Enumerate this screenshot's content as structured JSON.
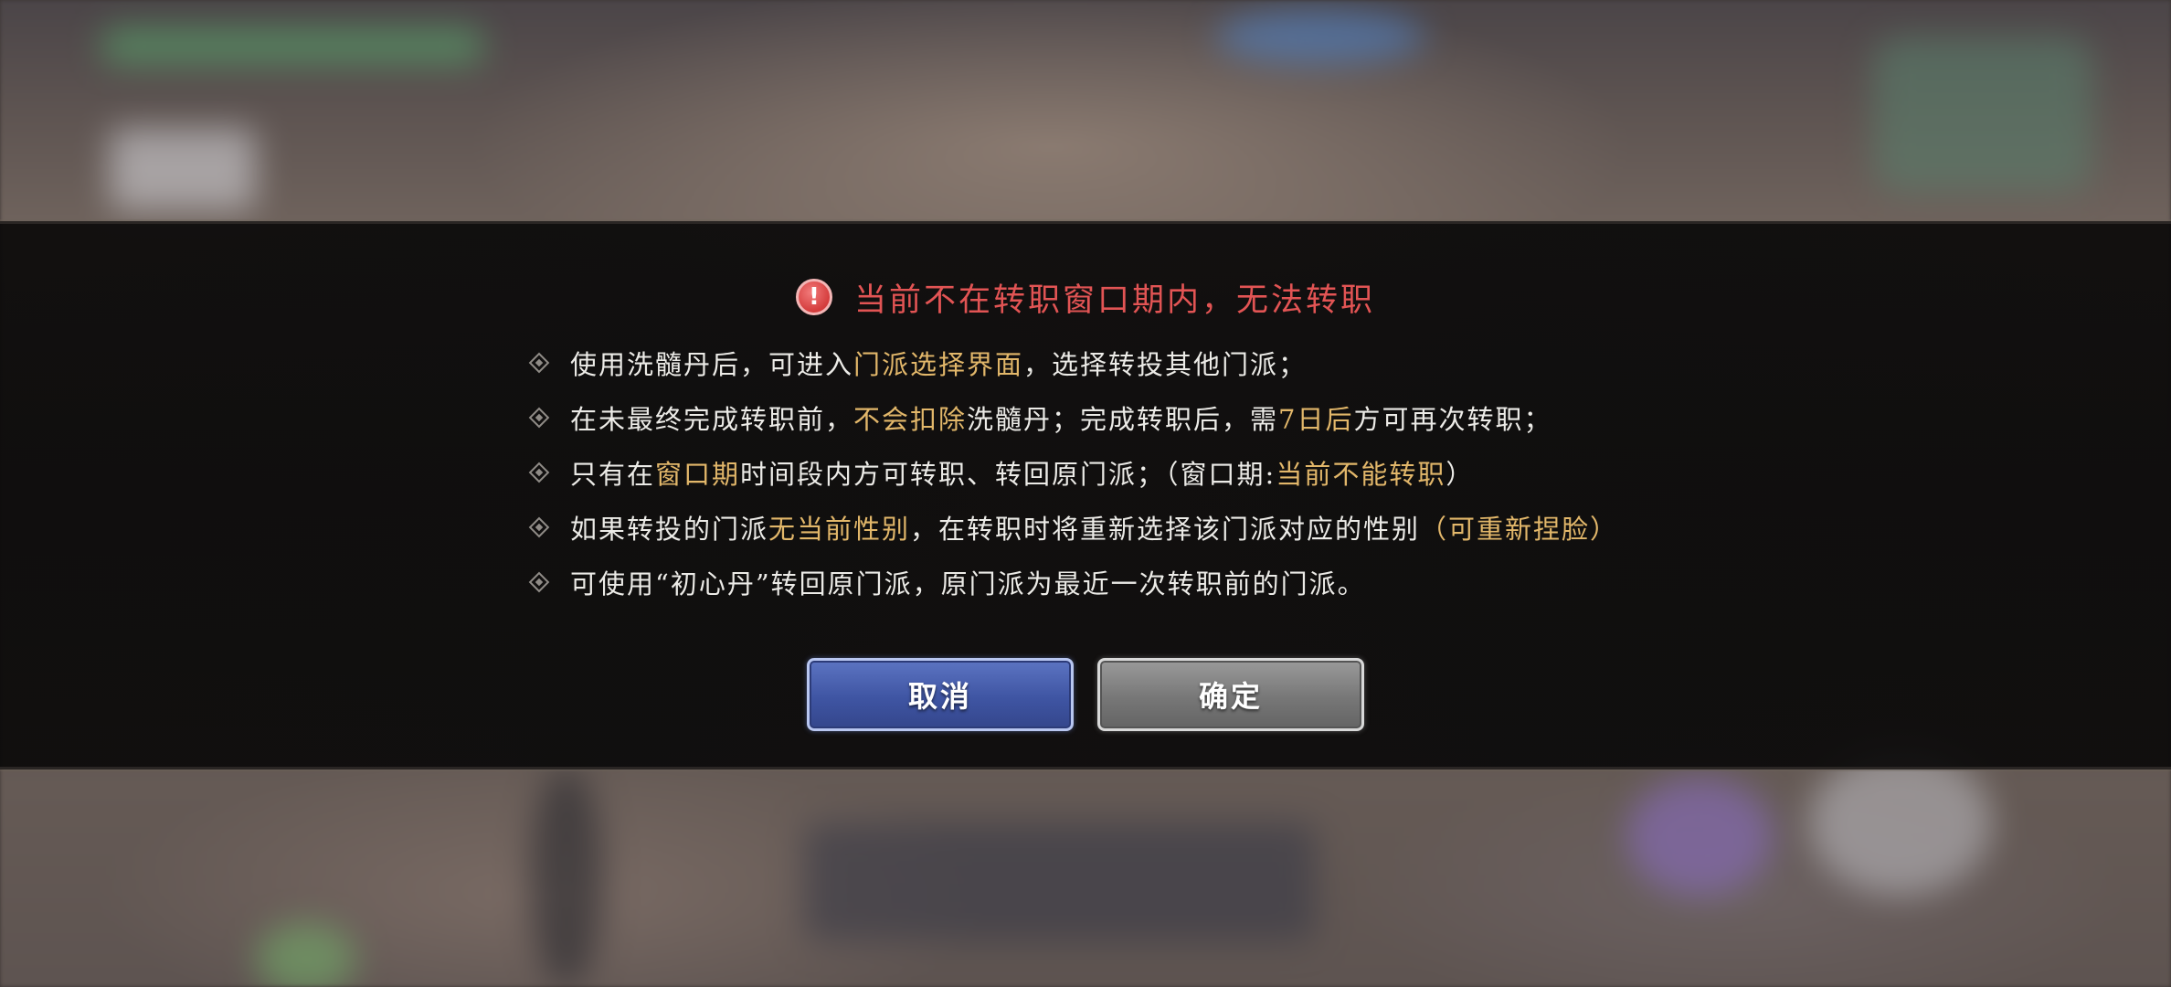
{
  "dialog": {
    "icon": "warning-icon",
    "icon_glyph": "!",
    "title": "当前不在转职窗口期内，无法转职",
    "rules": [
      {
        "parts": [
          {
            "text": "使用洗髓丹后，可进入",
            "highlight": false
          },
          {
            "text": "门派选择界面",
            "highlight": true
          },
          {
            "text": "，选择转投其他门派；",
            "highlight": false
          }
        ]
      },
      {
        "parts": [
          {
            "text": "在未最终完成转职前，",
            "highlight": false
          },
          {
            "text": "不会扣除",
            "highlight": true
          },
          {
            "text": "洗髓丹；完成转职后，需",
            "highlight": false
          },
          {
            "text": "7日后",
            "highlight": true
          },
          {
            "text": "方可再次转职；",
            "highlight": false
          }
        ]
      },
      {
        "parts": [
          {
            "text": "只有在",
            "highlight": false
          },
          {
            "text": "窗口期",
            "highlight": true
          },
          {
            "text": "时间段内方可转职、转回原门派；（窗口期:",
            "highlight": false
          },
          {
            "text": "当前不能转职",
            "highlight": true
          },
          {
            "text": "）",
            "highlight": false
          }
        ]
      },
      {
        "parts": [
          {
            "text": "如果转投的门派",
            "highlight": false
          },
          {
            "text": "无当前性别",
            "highlight": true
          },
          {
            "text": "，在转职时将重新选择该门派对应的性别",
            "highlight": false
          },
          {
            "text": "（可重新捏脸）",
            "highlight": true
          }
        ]
      },
      {
        "parts": [
          {
            "text": "可使用“初心丹”转回原门派，原门派为最近一次转职前的门派。",
            "highlight": false
          }
        ]
      }
    ],
    "buttons": {
      "cancel_label": "取消",
      "confirm_label": "确定"
    }
  },
  "colors": {
    "title_red": "#e25454",
    "highlight_gold": "#e2b76a",
    "body_text": "#ecebe7",
    "cancel_blue": "#3f55a3",
    "confirm_gray": "#777777"
  }
}
